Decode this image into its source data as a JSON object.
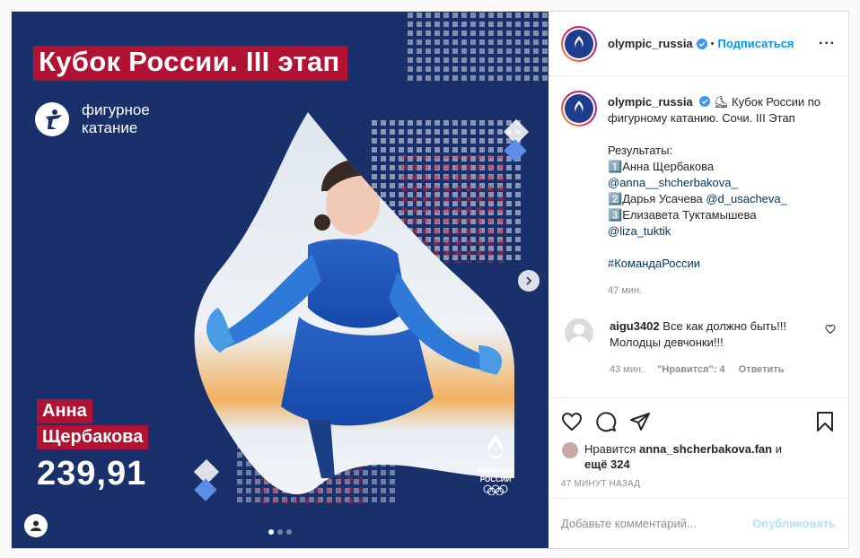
{
  "media": {
    "banner": "Кубок России. III этап",
    "sport_line1": "фигурное",
    "sport_line2": "катание",
    "name_line1": "Анна",
    "name_line2": "Щербакова",
    "score": "239,91",
    "team_line1": "КОМАНДА",
    "team_line2": "РОССИИ",
    "slide_count": 3,
    "active_slide": 1
  },
  "header": {
    "username": "olympic_russia",
    "separator": "•",
    "follow_label": "Подписаться",
    "more_label": "···"
  },
  "caption": {
    "username": "olympic_russia",
    "emoji": "⛸",
    "text": "Кубок России по фигурному катанию. Сочи. III Этап",
    "results_label": "Результаты:",
    "r1_num": "1️⃣",
    "r1_name": "Анна Щербакова",
    "r1_handle": "@anna__shcherbakova_",
    "r2_num": "2️⃣",
    "r2_name": "Дарья Усачева ",
    "r2_handle": "@d_usacheva_",
    "r3_num": "3️⃣",
    "r3_name": "Елизавета Туктамышева",
    "r3_handle": "@liza_tuktik",
    "hashtag": "#КомандаРоссии",
    "time": "47 мин."
  },
  "comment": {
    "username": "aigu3402",
    "text": "Все как должно быть!!! Молодцы девчонки!!!",
    "time": "43 мин.",
    "likes": "\"Нравится\": 4",
    "reply": "Ответить"
  },
  "likes": {
    "prefix": "Нравится ",
    "user": "anna_shcherbakova.fan",
    "middle": " и ",
    "others": "ещё 324"
  },
  "posted_ago": "47 МИНУТ НАЗАД",
  "add_comment": {
    "placeholder": "Добавьте комментарий...",
    "publish": "Опубликовать"
  },
  "colors": {
    "accent": "#0095f6",
    "banner_red": "#b11133",
    "media_bg": "#19306b"
  }
}
